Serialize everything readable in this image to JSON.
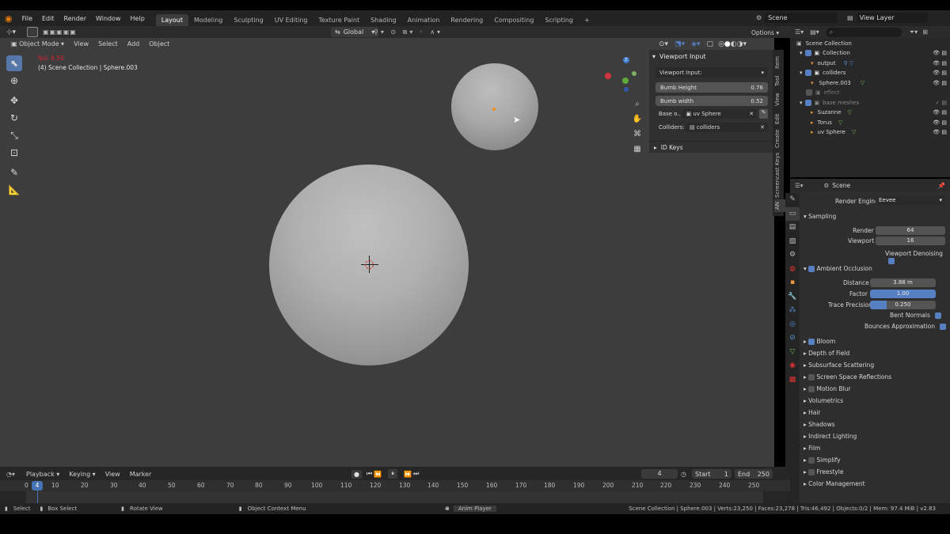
{
  "menu": [
    "File",
    "Edit",
    "Render",
    "Window",
    "Help"
  ],
  "workspaces": [
    "Layout",
    "Modeling",
    "Sculpting",
    "UV Editing",
    "Texture Paint",
    "Shading",
    "Animation",
    "Rendering",
    "Compositing",
    "Scripting"
  ],
  "active_workspace": "Layout",
  "scene": "Scene",
  "view_layer": "View Layer",
  "viewport": {
    "mode": "Object Mode",
    "menu": [
      "View",
      "Select",
      "Add",
      "Object"
    ],
    "transform_orientation": "Global",
    "options": "Options",
    "fps": "fps: 6.50",
    "object_info": "(4) Scene Collection | Sphere.003"
  },
  "npanel": {
    "header": "Viewport Input",
    "dropdown": "Viewport Input:",
    "bumb_height_label": "Bumb Height",
    "bumb_height_value": "0.76",
    "bumb_width_label": "Bumb width",
    "bumb_width_value": "0.52",
    "base_label": "Base o..",
    "base_value": "uv Sphere",
    "colliders_label": "Colliders:",
    "colliders_value": "colliders",
    "id_keys": "ID Keys",
    "tabs": [
      "Item",
      "Tool",
      "View",
      "Edit",
      "Create",
      "Screencast Keys",
      "AN"
    ]
  },
  "outliner": {
    "root": "Scene Collection",
    "items": [
      {
        "name": "Collection",
        "indent": 1
      },
      {
        "name": "output",
        "indent": 2
      },
      {
        "name": "colliders",
        "indent": 1
      },
      {
        "name": "Sphere.003",
        "indent": 2
      },
      {
        "name": "effect",
        "indent": 1
      },
      {
        "name": "base meshes",
        "indent": 1
      },
      {
        "name": "Suzanne",
        "indent": 2
      },
      {
        "name": "Torus",
        "indent": 2
      },
      {
        "name": "uv Sphere",
        "indent": 2
      }
    ]
  },
  "properties": {
    "context": "Scene",
    "render_engine_label": "Render Engine",
    "render_engine": "Eevee",
    "sampling": "Sampling",
    "render_label": "Render",
    "render_value": "64",
    "viewport_label": "Viewport",
    "viewport_value": "16",
    "viewport_denoising": "Viewport Denoising",
    "ambient_occlusion": "Ambient Occlusion",
    "distance_label": "Distance",
    "distance_value": "3.88 m",
    "factor_label": "Factor",
    "factor_value": "1.00",
    "trace_label": "Trace Precision",
    "trace_value": "0.250",
    "bent_normals": "Bent Normals",
    "bounces": "Bounces Approximation",
    "panels": [
      "Bloom",
      "Depth of Field",
      "Subsurface Scattering",
      "Screen Space Reflections",
      "Motion Blur",
      "Volumetrics",
      "Hair",
      "Shadows",
      "Indirect Lighting",
      "Film",
      "Simplify",
      "Freestyle",
      "Color Management"
    ]
  },
  "timeline": {
    "menu": [
      "Playback",
      "Keying",
      "View",
      "Marker"
    ],
    "current_frame": "4",
    "start_label": "Start",
    "start": "1",
    "end_label": "End",
    "end": "250",
    "ticks": [
      "0",
      "10",
      "20",
      "30",
      "40",
      "50",
      "60",
      "70",
      "80",
      "90",
      "100",
      "110",
      "120",
      "130",
      "140",
      "150",
      "160",
      "170",
      "180",
      "190",
      "200",
      "210",
      "220",
      "230",
      "240",
      "250"
    ]
  },
  "status": {
    "select": "Select",
    "box_select": "Box Select",
    "rotate_view": "Rotate View",
    "context_menu": "Object Context Menu",
    "anim_player": "Anim Player",
    "stats": "Scene Collection | Sphere.003 | Verts:23,250 | Faces:23,278 | Tris:46,492 | Objects:0/2 | Mem: 97.4 MiB | v2.83"
  },
  "colors": {
    "accent": "#5680c2",
    "viewport": "#3d3d3d"
  }
}
